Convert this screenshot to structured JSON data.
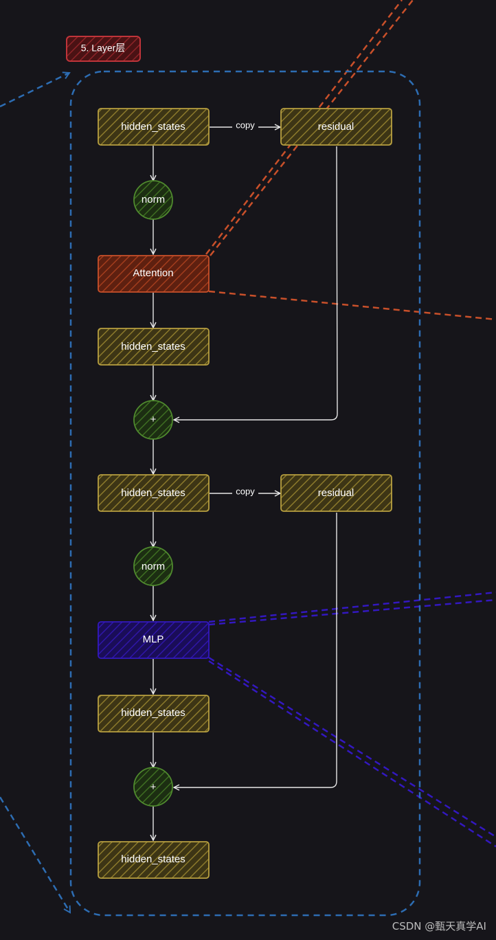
{
  "diagram": {
    "title": "5. Layer层",
    "colors": {
      "background": "#16151a",
      "container_border": "#2d6db3",
      "tensor_stroke": "#b8a040",
      "tensor_fill": "#6b5d1e",
      "op_stroke": "#4f8a2e",
      "op_fill": "#2b4a1a",
      "attention_stroke": "#c9502a",
      "attention_fill": "#8a2f17",
      "mlp_stroke": "#3318c0",
      "mlp_fill": "#24127a",
      "title_stroke": "#c0343a",
      "title_fill": "#6e1a1c",
      "edge": "#e8e8e8"
    },
    "nodes": {
      "hs1": "hidden_states",
      "res1": "residual",
      "norm1": "norm",
      "attn": "Attention",
      "hs2": "hidden_states",
      "add1": "+",
      "hs3": "hidden_states",
      "res2": "residual",
      "norm2": "norm",
      "mlp": "MLP",
      "hs4": "hidden_states",
      "add2": "+",
      "hs5": "hidden_states"
    },
    "edges": {
      "copy1": "copy",
      "copy2": "copy"
    }
  },
  "watermark": "CSDN @甄天真学AI"
}
